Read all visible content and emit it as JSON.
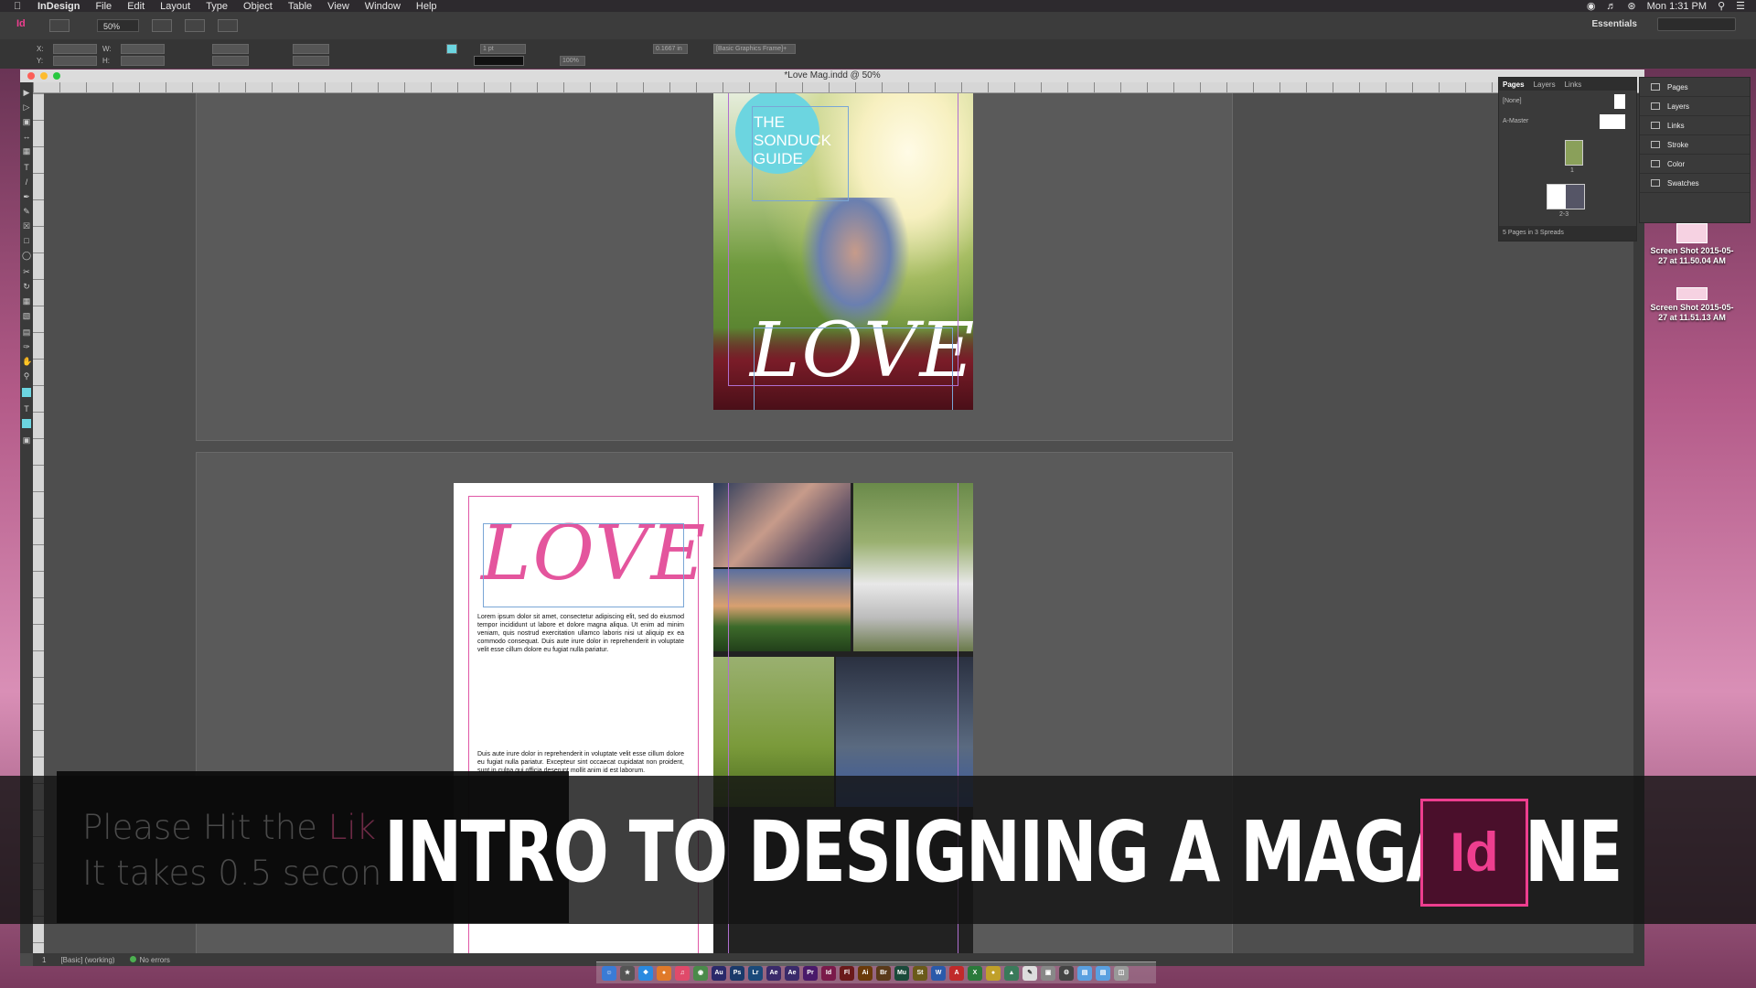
{
  "menubar": {
    "app": "InDesign",
    "items": [
      "File",
      "Edit",
      "Layout",
      "Type",
      "Object",
      "Table",
      "View",
      "Window",
      "Help"
    ],
    "clock": "Mon 1:31 PM"
  },
  "control": {
    "zoom": "50%",
    "workspace": "Essentials",
    "stroke_weight": "1 pt",
    "object_style": "[Basic Graphics Frame]+",
    "scale": "100%",
    "ref_value": "0.1667 in"
  },
  "document": {
    "title": "*Love Mag.indd @ 50%"
  },
  "cover": {
    "circle_text": "THE SONDUCK GUIDE",
    "love": "LOVE"
  },
  "spread2": {
    "love": "LOVE",
    "body": "Lorem ipsum dolor sit amet, consectetur adipiscing elit, sed do eiusmod tempor incididunt ut labore et dolore magna aliqua. Ut enim ad minim veniam, quis nostrud exercitation ullamco laboris nisi ut aliquip ex ea commodo consequat. Duis aute irure dolor in reprehenderit in voluptate velit esse cillum dolore eu fugiat nulla pariatur.",
    "body_end": "Duis aute irure dolor in reprehenderit in voluptate velit esse cillum dolore eu fugiat nulla pariatur. Excepteur sint occaecat cupidatat non proident, sunt in culpa qui officia deserunt mollit anim id est laborum."
  },
  "panels": {
    "tabs": [
      "Pages",
      "Layers",
      "Links"
    ],
    "none": "[None]",
    "master": "A-Master",
    "page1": "1",
    "page23": "2-3",
    "summary": "5 Pages in 3 Spreads",
    "dock": [
      "Pages",
      "Layers",
      "Links",
      "Stroke",
      "Color",
      "Swatches"
    ]
  },
  "desktop": {
    "file1": "Screen Shot 2015-05-27 at 11.50.04 AM",
    "file2": "Screen Shot 2015-05-27 at 11.51.13 AM"
  },
  "status": {
    "page": "1",
    "preflight_profile": "[Basic] (working)",
    "errors": "No errors"
  },
  "overlay": {
    "like_line1_a": "Please Hit the ",
    "like_line1_b": "Lik",
    "like_line2": "It takes 0.5 secon",
    "title": "INTRO TO DESIGNING A MAGAZINE",
    "badge": "Id"
  },
  "colors": {
    "accent": "#ee3e8f",
    "circle": "#6cd5e0",
    "love_pink": "#e4559d"
  }
}
